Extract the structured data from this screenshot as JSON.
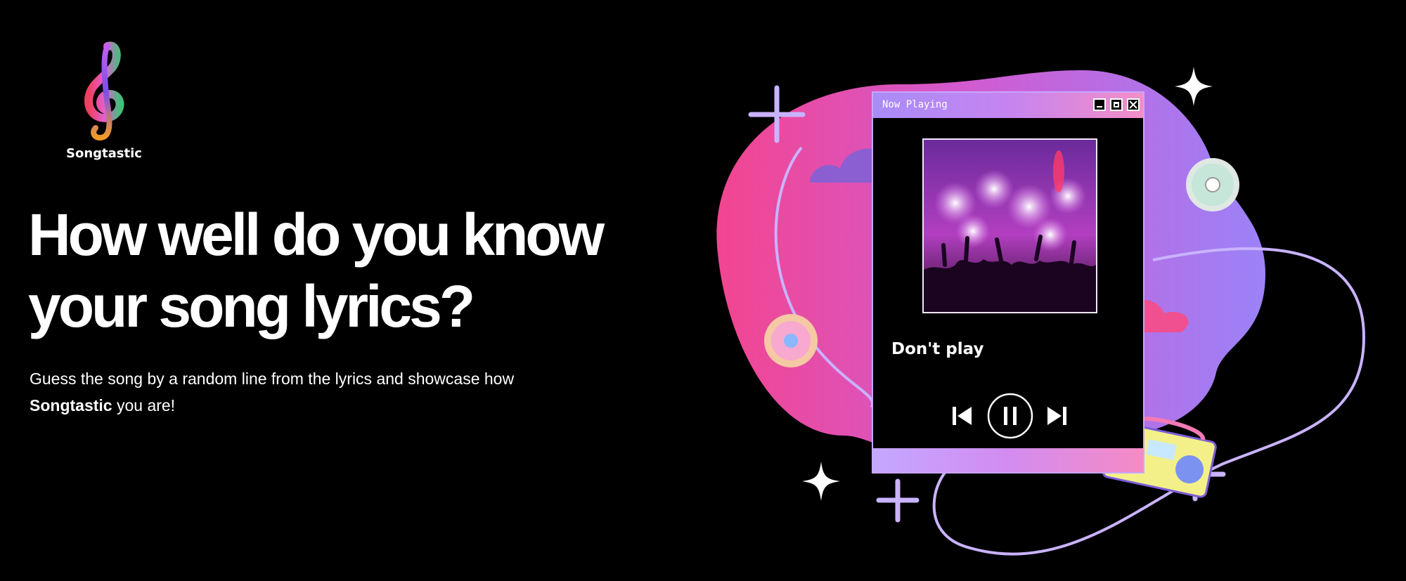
{
  "brand": {
    "name": "Songtastic"
  },
  "hero": {
    "headline_line1": "How well do you know",
    "headline_line2": "your song lyrics?",
    "subtitle_prefix": "Guess the song by a random line from the lyrics and showcase how",
    "subtitle_brand": "Songtastic",
    "subtitle_suffix": "you are!"
  },
  "player": {
    "window_title": "Now Playing",
    "song_title": "Don't play",
    "icons": {
      "minimize": "minimize-icon",
      "maximize": "maximize-icon",
      "close": "close-icon",
      "previous": "skip-previous-icon",
      "pause": "pause-icon",
      "next": "skip-next-icon"
    }
  },
  "colors": {
    "background": "#000000",
    "pink": "#f2458f",
    "purple": "#a17ff5",
    "lavender": "#c9b3ff",
    "cloud_purple": "#8b5fd1",
    "cloud_pink": "#f0508f"
  }
}
